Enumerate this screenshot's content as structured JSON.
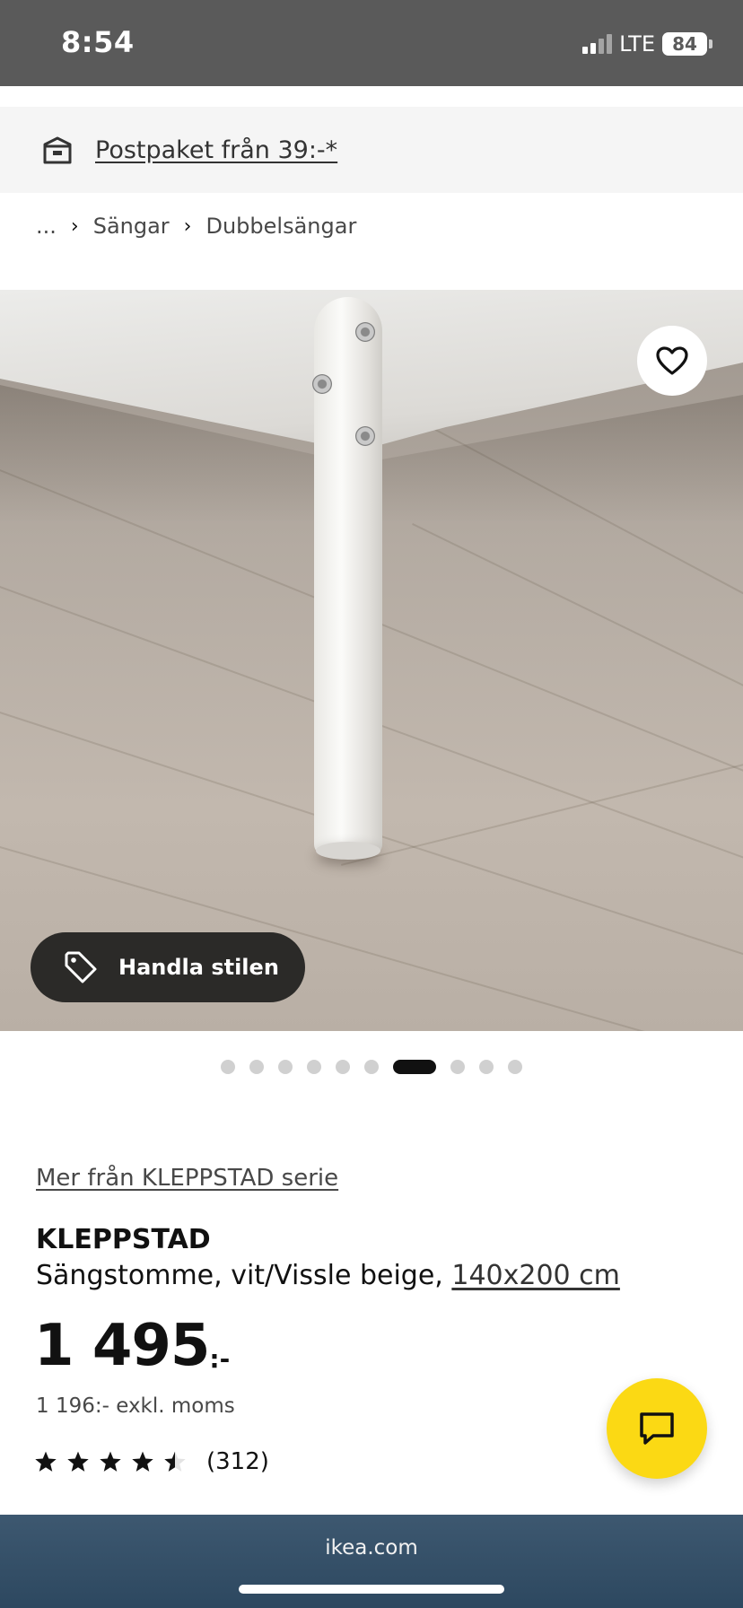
{
  "status_bar": {
    "time": "8:54",
    "network": "LTE",
    "battery": "84"
  },
  "banner": {
    "icon": "package-icon",
    "text": "Postpaket från 39:-*"
  },
  "breadcrumb": {
    "items": [
      "...",
      "Sängar",
      "Dubbelsängar"
    ]
  },
  "hero": {
    "favorite_icon": "heart-icon",
    "shop_style_label": "Handla stilen",
    "shop_style_icon": "tag-icon",
    "dots_total": 10,
    "active_dot": 7
  },
  "product": {
    "series_link": "Mer från KLEPPSTAD serie",
    "name": "KLEPPSTAD",
    "description": "Sängstomme, vit/Vissle beige, ",
    "size_link": "140x200 cm",
    "price": "1 495",
    "price_suffix": ":-",
    "price_ex_vat": "1 196:- exkl. moms",
    "rating": 4.5,
    "review_count": "(312)"
  },
  "chat": {
    "icon": "chat-icon",
    "color": "#fbd914"
  },
  "browser": {
    "url": "ikea.com"
  }
}
